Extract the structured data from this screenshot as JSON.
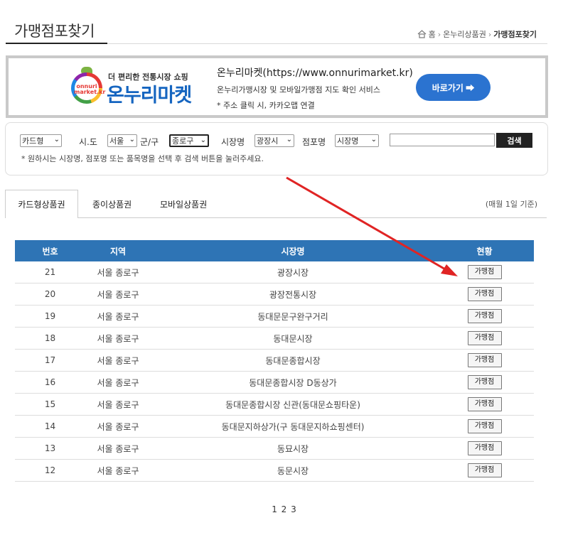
{
  "header": {
    "title": "가맹점포찾기",
    "breadcrumb": {
      "home": "홈",
      "level1": "온누리상품권",
      "current": "가맹점포찾기"
    }
  },
  "banner": {
    "logo_tagline": "더 편리한 전통시장 쇼핑",
    "logo_name": "온누리마켓",
    "logo_sub": "onnuri market.kr",
    "line1": "온누리마켓(https://www.onnurimarket.kr)",
    "line2": "온누리가맹시장 및 모바일가맹점 지도 확인 서비스",
    "line3": "* 주소 클릭 시, 카카오맵 연결",
    "button": "바로가기 ➡"
  },
  "search": {
    "card_type": "카드형",
    "label_sido": "시.도",
    "sido_value": "서울",
    "label_gungu": "군/구",
    "gungu_value": "종로구",
    "label_market": "시장명",
    "market_value": "광장시",
    "label_store": "점포명",
    "store_value": "시장명",
    "keyword": "",
    "button": "검색",
    "hint": "* 원하시는 시장명, 점포명 또는 품목명을 선택 후 검색 버튼을 눌러주세요."
  },
  "tabs": {
    "items": [
      "카드형상품권",
      "종이상품권",
      "모바일상품권"
    ],
    "note": "(매월 1일 기준)"
  },
  "table": {
    "headers": [
      "번호",
      "지역",
      "시장명",
      "현황"
    ],
    "button_label": "가맹점",
    "rows": [
      {
        "no": "21",
        "region": "서울 종로구",
        "market": "광장시장"
      },
      {
        "no": "20",
        "region": "서울 종로구",
        "market": "광장전통시장"
      },
      {
        "no": "19",
        "region": "서울 종로구",
        "market": "동대문문구완구거리"
      },
      {
        "no": "18",
        "region": "서울 종로구",
        "market": "동대문시장"
      },
      {
        "no": "17",
        "region": "서울 종로구",
        "market": "동대문종합시장"
      },
      {
        "no": "16",
        "region": "서울 종로구",
        "market": "동대문종합시장 D동상가"
      },
      {
        "no": "15",
        "region": "서울 종로구",
        "market": "동대문종합시장 신관(동대문쇼핑타운)"
      },
      {
        "no": "14",
        "region": "서울 종로구",
        "market": "동대문지하상가(구 동대문지하쇼핑센터)"
      },
      {
        "no": "13",
        "region": "서울 종로구",
        "market": "동묘시장"
      },
      {
        "no": "12",
        "region": "서울 종로구",
        "market": "동문시장"
      }
    ]
  },
  "pagination": [
    "1",
    "2",
    "3"
  ],
  "annotation": {
    "arrow_color": "#e02424"
  }
}
